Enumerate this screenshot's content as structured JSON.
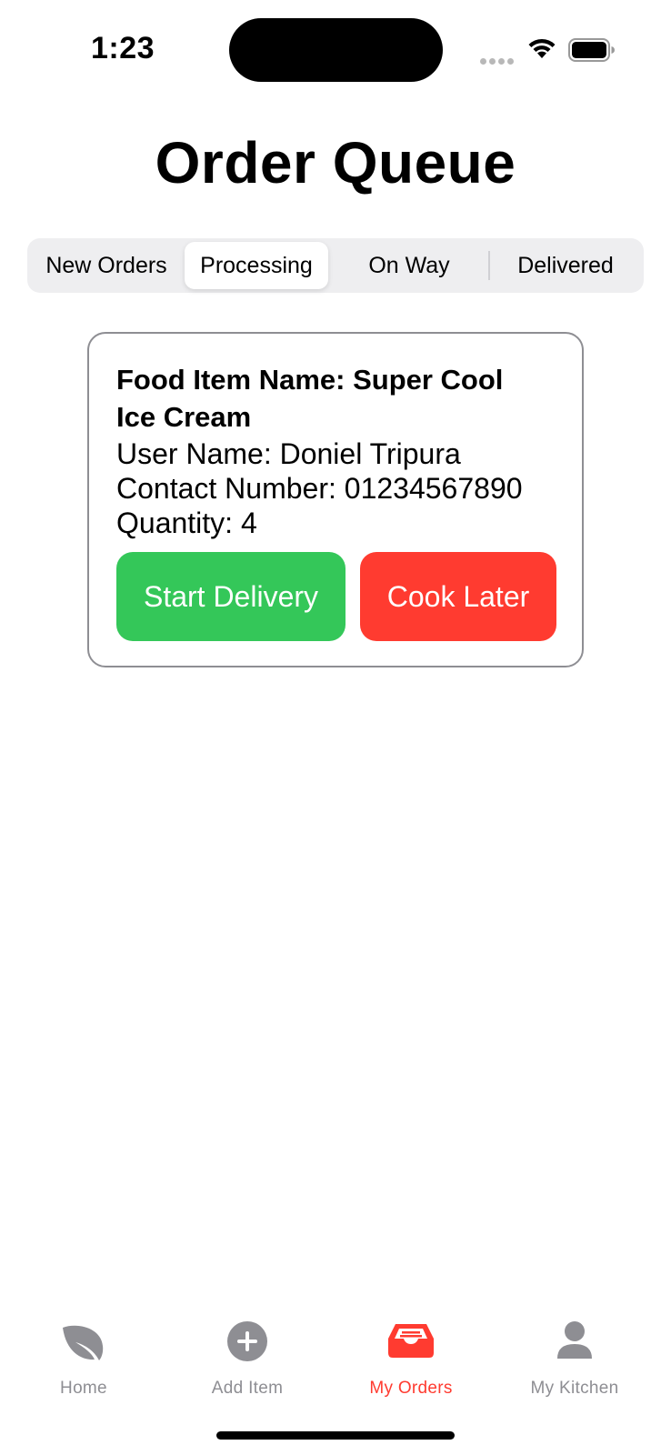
{
  "status_bar": {
    "time": "1:23",
    "icons": [
      "cellular-signal-icon",
      "wifi-icon",
      "battery-icon"
    ]
  },
  "page": {
    "title": "Order Queue"
  },
  "segments": {
    "items": [
      "New Orders",
      "Processing",
      "On Way",
      "Delivered"
    ],
    "selected": "Processing"
  },
  "order": {
    "food_name": "Food Item Name: Super Cool Ice Cream",
    "user_name": "User Name: Doniel Tripura",
    "contact": "Contact Number: 01234567890",
    "quantity": "Quantity: 4",
    "start_button": "Start Delivery",
    "later_button": "Cook Later"
  },
  "tab_bar": {
    "items": [
      {
        "label": "Home",
        "icon": "leaf-icon"
      },
      {
        "label": "Add Item",
        "icon": "plus-circle-icon"
      },
      {
        "label": "My Orders",
        "icon": "tray-icon"
      },
      {
        "label": "My Kitchen",
        "icon": "person-icon"
      }
    ],
    "active": "My Orders"
  },
  "colors": {
    "accent": "#ff3b30",
    "success": "#34c759",
    "inactive": "#8e8e93",
    "segment_bg": "#eeeef0"
  }
}
